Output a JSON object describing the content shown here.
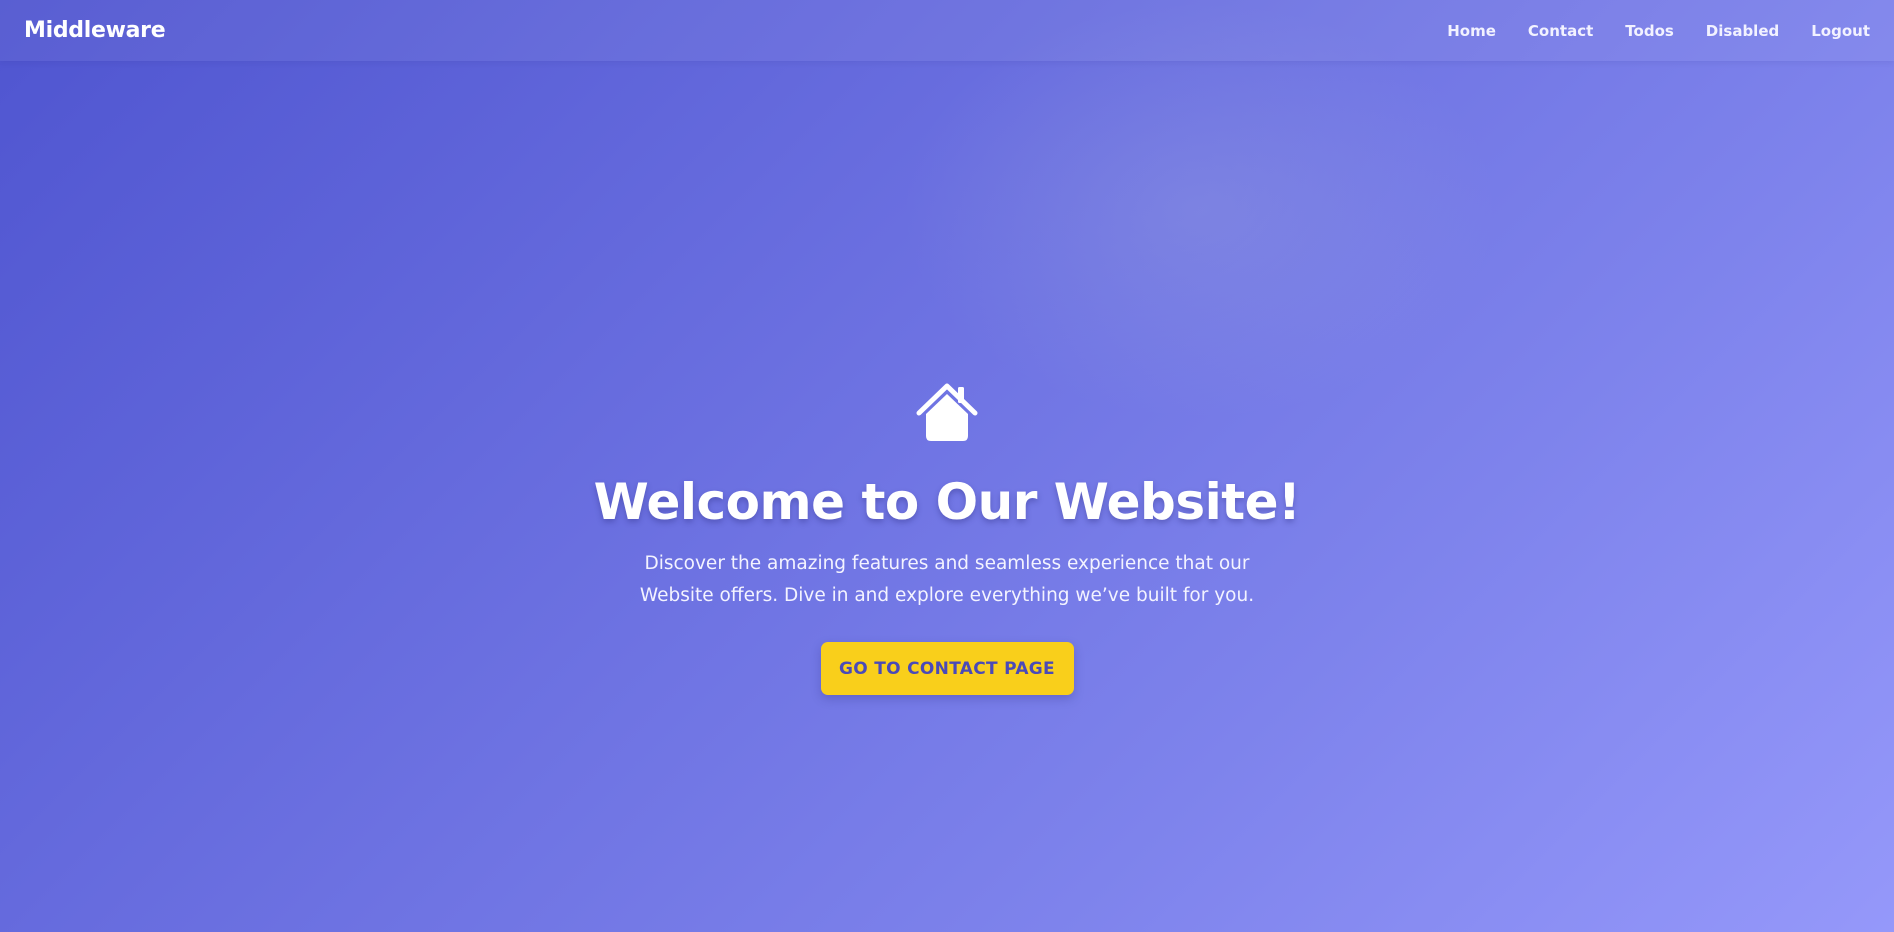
{
  "header": {
    "brand": "Middleware",
    "nav": [
      {
        "label": "Home"
      },
      {
        "label": "Contact"
      },
      {
        "label": "Todos"
      },
      {
        "label": "Disabled"
      },
      {
        "label": "Logout"
      }
    ]
  },
  "hero": {
    "icon": "home-icon",
    "title": "Welcome to Our Website!",
    "subtitle": "Discover the amazing features and seamless experience that our Website offers. Dive in and explore everything we’ve built for you.",
    "cta_label": "GO TO CONTACT PAGE"
  },
  "colors": {
    "gradient_start": "#4f55d0",
    "gradient_end": "#9598fa",
    "cta_background": "#f9cf1b",
    "cta_text": "#4a4ab8",
    "text": "#ffffff"
  }
}
